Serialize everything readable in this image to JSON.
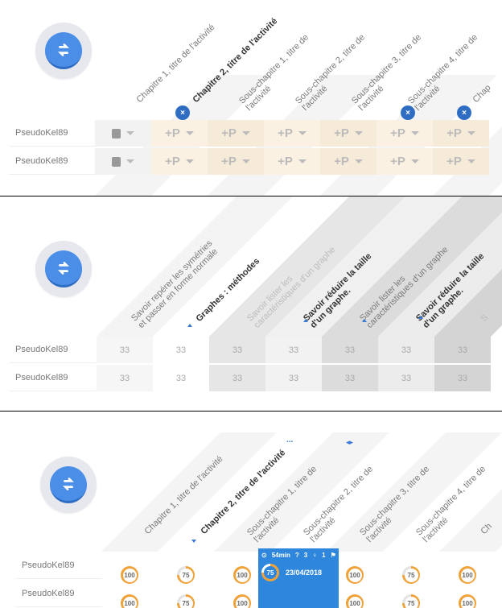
{
  "panel1": {
    "headers": [
      "Chapitre 1, titre de l'activité",
      "Chapitre 2, titre de l'activité",
      "Sous-chapitre 1, titre de l'activité",
      "Sous-chapitre 2, titre de l'activité",
      "Sous-chapitre 3, titre de l'activité",
      "Sous-chapitre 4, titre de l'activité",
      "Chap"
    ],
    "bold_index": 1,
    "badge": "×",
    "pseudo": "PseudoKel89",
    "plus": "+P"
  },
  "panel2": {
    "headers": [
      "Savoir repérer les symétries et passer en forme normale",
      "Graphes : méthodes",
      "Savoir lister les caractéristiques d'un graphe",
      "Savoir réduire la taille d'un graphe.",
      "Savoir lister les caractéristiques d'un graphe",
      "Savoir réduire la taille d'un graphe.",
      "S"
    ],
    "pseudo": "PseudoKel89",
    "value": "33"
  },
  "panel3": {
    "headers": [
      "Chapitre 1, titre de l'activité",
      "Chapitre 2, titre de l'activité",
      "Sous-chapitre 1, titre de l'activité",
      "Sous-chapitre 2, titre de l'activité",
      "Sous-chapitre 3, titre de l'activité",
      "Sous-chapitre 4, titre de l'activité",
      "Ch"
    ],
    "pseudo": "PseudoKel89",
    "pseudo_partial": "PseudoKel89",
    "scores": [
      "100",
      "75",
      "100",
      "75",
      "100",
      "75",
      "100"
    ],
    "ellipsis": "...",
    "arrows": "◂▸",
    "popup": {
      "time": "54min",
      "q": "3",
      "pin": "1",
      "flag": "3",
      "score": "75",
      "date": "23/04/2018"
    }
  },
  "icons": {
    "sync": "sync-icon",
    "lock": "lock-icon",
    "close": "close-icon"
  },
  "colors": {
    "accent": "#2f6dc3",
    "sync": "#4a8ee8",
    "cream": "#fbf1e2",
    "grey": "#e3e3e3",
    "ring": "#f0a23a"
  }
}
